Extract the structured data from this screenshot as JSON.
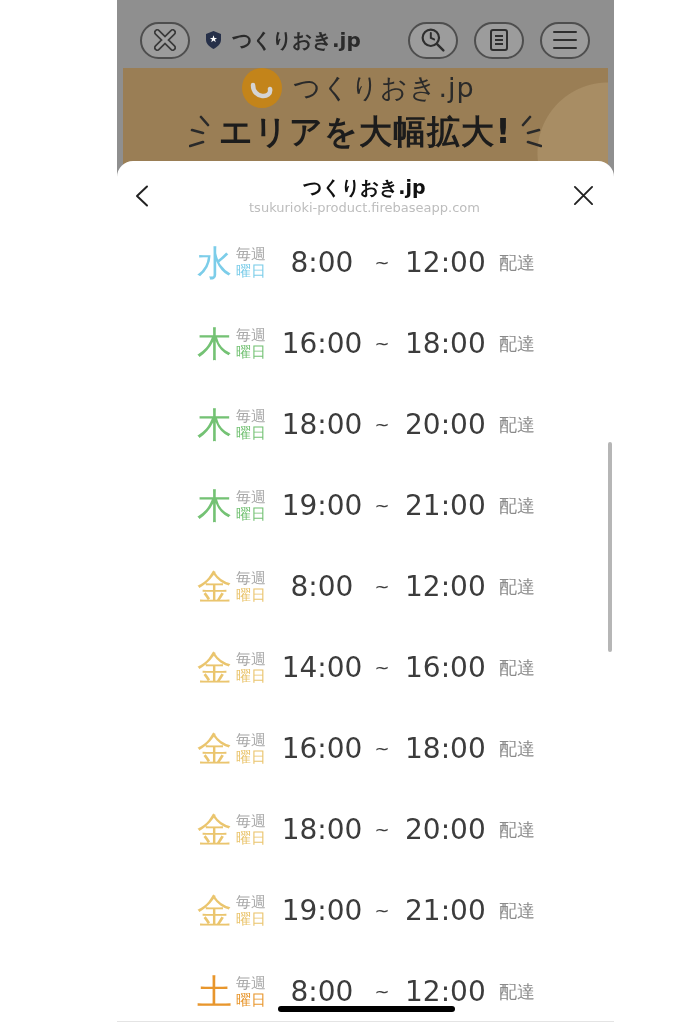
{
  "toolbar": {
    "site_title": "つくりおき.jp"
  },
  "banner": {
    "brand": "つくりおき.jp",
    "headline": "エリアを大幅拡大!"
  },
  "sheet": {
    "title": "つくりおき.jp",
    "url": "tsukurioki-product.firebaseapp.com"
  },
  "slots": [
    {
      "day": "水",
      "weekly": "毎週",
      "weekday": "曜日",
      "start": "8:00",
      "separator": "~",
      "end": "12:00",
      "action": "配達",
      "color": "#7ccde9"
    },
    {
      "day": "木",
      "weekly": "毎週",
      "weekday": "曜日",
      "start": "16:00",
      "separator": "~",
      "end": "18:00",
      "action": "配達",
      "color": "#74c274"
    },
    {
      "day": "木",
      "weekly": "毎週",
      "weekday": "曜日",
      "start": "18:00",
      "separator": "~",
      "end": "20:00",
      "action": "配達",
      "color": "#74c274"
    },
    {
      "day": "木",
      "weekly": "毎週",
      "weekday": "曜日",
      "start": "19:00",
      "separator": "~",
      "end": "21:00",
      "action": "配達",
      "color": "#74c274"
    },
    {
      "day": "金",
      "weekly": "毎週",
      "weekday": "曜日",
      "start": "8:00",
      "separator": "~",
      "end": "12:00",
      "action": "配達",
      "color": "#eac56e"
    },
    {
      "day": "金",
      "weekly": "毎週",
      "weekday": "曜日",
      "start": "14:00",
      "separator": "~",
      "end": "16:00",
      "action": "配達",
      "color": "#eac56e"
    },
    {
      "day": "金",
      "weekly": "毎週",
      "weekday": "曜日",
      "start": "16:00",
      "separator": "~",
      "end": "18:00",
      "action": "配達",
      "color": "#eac56e"
    },
    {
      "day": "金",
      "weekly": "毎週",
      "weekday": "曜日",
      "start": "18:00",
      "separator": "~",
      "end": "20:00",
      "action": "配達",
      "color": "#eac56e"
    },
    {
      "day": "金",
      "weekly": "毎週",
      "weekday": "曜日",
      "start": "19:00",
      "separator": "~",
      "end": "21:00",
      "action": "配達",
      "color": "#eac56e"
    },
    {
      "day": "土",
      "weekly": "毎週",
      "weekday": "曜日",
      "start": "8:00",
      "separator": "~",
      "end": "12:00",
      "action": "配達",
      "color": "#e8962c"
    }
  ]
}
